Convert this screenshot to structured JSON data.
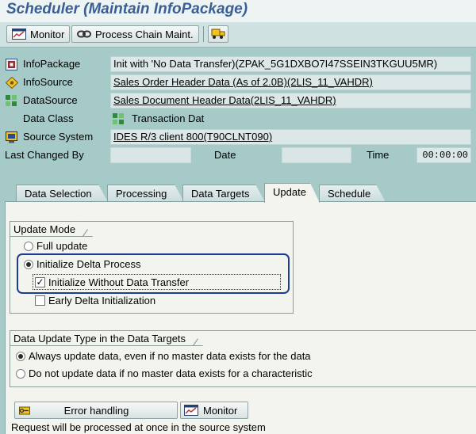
{
  "window": {
    "title": "Scheduler (Maintain InfoPackage)"
  },
  "toolbar": {
    "monitor_label": "Monitor",
    "process_chain_label": "Process Chain Maint."
  },
  "fields": {
    "infopackage": {
      "label": "InfoPackage",
      "value": "Init with 'No Data Transfer)(ZPAK_5G1DXBO7I47SSEIN3TKGUU5MR)"
    },
    "infosource": {
      "label": "InfoSource",
      "value": "Sales Order Header Data (As of 2.0B)(2LIS_11_VAHDR)"
    },
    "datasource": {
      "label": "DataSource",
      "value": "Sales Document Header Data(2LIS_11_VAHDR)"
    },
    "data_class": {
      "label": "Data Class",
      "value": "Transaction Dat"
    },
    "source_system": {
      "label": "Source System",
      "value": "IDES R/3 client 800(T90CLNT090)"
    },
    "last_changed_by": {
      "label": "Last Changed By",
      "value": ""
    },
    "date": {
      "label": "Date",
      "value": ""
    },
    "time": {
      "label": "Time",
      "value": "00:00:00"
    }
  },
  "tabs": [
    {
      "label": "Data Selection",
      "active": false
    },
    {
      "label": "Processing",
      "active": false
    },
    {
      "label": "Data Targets",
      "active": false
    },
    {
      "label": "Update",
      "active": true
    },
    {
      "label": "Schedule",
      "active": false
    }
  ],
  "update_mode": {
    "title": "Update Mode",
    "full_update": "Full update",
    "init_delta": "Initialize Delta Process",
    "init_without_transfer": "Initialize Without Data Transfer",
    "early_delta": "Early Delta Initialization",
    "selected": "init_delta",
    "init_without_transfer_checked": true,
    "early_delta_checked": false
  },
  "data_update_type": {
    "title": "Data Update Type in the Data Targets",
    "always": "Always update data, even if no master data exists for the data",
    "do_not": "Do not update data if no master data exists for a characteristic",
    "selected": "always"
  },
  "buttons": {
    "error_handling": "Error handling",
    "monitor": "Monitor"
  },
  "status": {
    "text": "Request will be processed at once in the source system"
  },
  "colors": {
    "background": "#a5cac8",
    "title_text": "#3a5f96",
    "panel": "#f4f4ee",
    "highlight": "#1a3d96"
  },
  "icons": {
    "monitor": "monitor-icon",
    "process_chain": "chain-icon",
    "transport": "transport-truck-icon",
    "infopackage": "infopackage-icon",
    "infosource": "infosource-icon",
    "datasource": "datasource-icon",
    "data_class": "data-class-icon",
    "source_system": "source-system-icon",
    "error_handling": "error-handling-icon"
  }
}
